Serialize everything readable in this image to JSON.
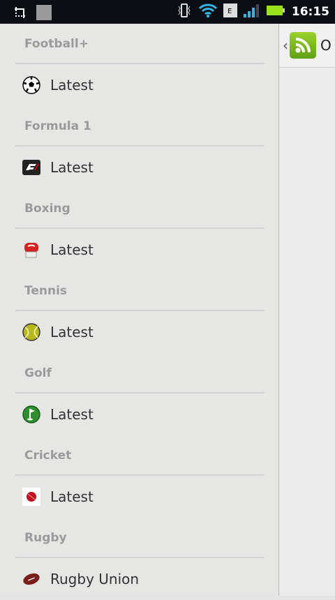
{
  "status": {
    "time": "16:15"
  },
  "sections": [
    {
      "header": "Football+",
      "item": "Latest",
      "icon": "football-icon"
    },
    {
      "header": "Formula 1",
      "item": "Latest",
      "icon": "formula1-icon"
    },
    {
      "header": "Boxing",
      "item": "Latest",
      "icon": "boxing-glove-icon"
    },
    {
      "header": "Tennis",
      "item": "Latest",
      "icon": "tennis-ball-icon"
    },
    {
      "header": "Golf",
      "item": "Latest",
      "icon": "golf-flag-icon"
    },
    {
      "header": "Cricket",
      "item": "Latest",
      "icon": "cricket-ball-icon"
    },
    {
      "header": "Rugby",
      "item": "Rugby Union",
      "icon": "rugby-ball-icon"
    }
  ],
  "right_panel": {
    "title_partial": "O"
  }
}
